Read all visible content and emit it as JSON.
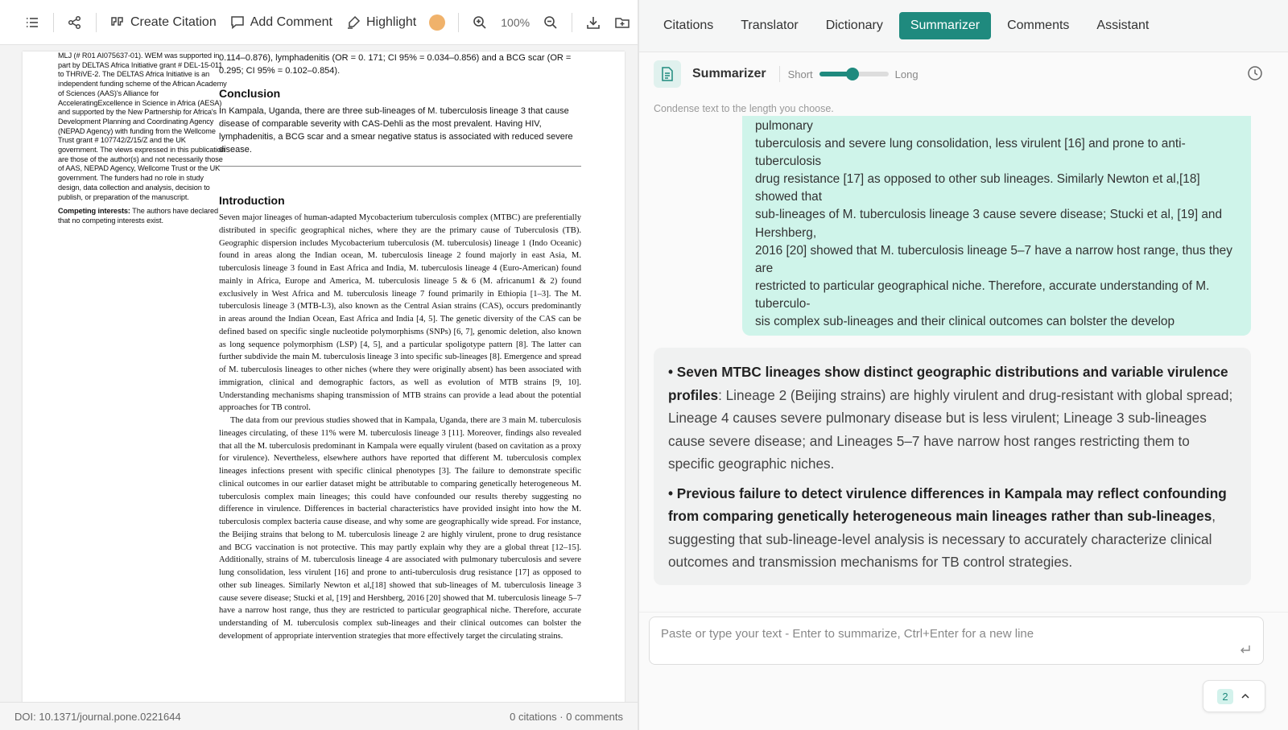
{
  "toolbar": {
    "create_citation": "Create Citation",
    "add_comment": "Add Comment",
    "highlight": "Highlight",
    "highlight_color": "#f0b26b",
    "zoom": "100%"
  },
  "document": {
    "side_column": [
      "MLJ (# R01 AI075637-01). WEM was supported in part by DELTAS Africa Initiative grant # DEL-15-011 to THRiVE-2. The DELTAS Africa Initiative is an independent funding scheme of the African Academy of Sciences (AAS)'s Alliance for AcceleratingExcellence in Science in Africa (AESA) and supported by the New Partnership for Africa's Development Planning and Coordinating Agency (NEPAD Agency) with funding from the Wellcome Trust grant # 107742/Z/15/Z and the UK government. The views expressed in this publication are those of the author(s) and not necessarily those of AAS, NEPAD Agency, Wellcome Trust or the UK government. The funders had no role in study design, data collection and analysis, decision to publish, or preparation of the manuscript."
    ],
    "competing_label": "Competing interests:",
    "competing_text": " The authors have declared that no competing interests exist.",
    "top_text": "0.114–0.876), lymphadenitis (OR = 0. 171; CI 95% = 0.034–0.856) and a BCG scar (OR = 0.295; CI 95% = 0.102–0.854).",
    "conclusion_heading": "Conclusion",
    "conclusion_text": "In Kampala, Uganda, there are three sub-lineages of M. tuberculosis lineage 3 that cause disease of comparable severity with CAS-Dehli as the most prevalent. Having HIV, lymphadenitis, a BCG scar and a smear negative status is associated with reduced severe disease.",
    "introduction_heading": "Introduction",
    "intro_p1": "Seven major lineages of human-adapted Mycobacterium tuberculosis complex (MTBC) are preferentially distributed in specific geographical niches, where they are the primary cause of Tuberculosis (TB). Geographic dispersion includes Mycobacterium tuberculosis (M. tuberculosis) lineage 1 (Indo Oceanic) found in areas along the Indian ocean, M. tuberculosis lineage 2 found majorly in east Asia, M. tuberculosis lineage 3 found in East Africa and India, M. tuberculosis lineage 4 (Euro-American) found mainly in Africa, Europe and America, M. tuberculosis lineage 5 & 6 (M. africanum1 & 2) found exclusively in West Africa and M. tuberculosis lineage 7 found primarily in Ethiopia [1–3]. The M. tuberculosis lineage 3 (MTB-L3), also known as the Central Asian strains (CAS), occurs predominantly in areas around the Indian Ocean, East Africa and India [4, 5]. The genetic diversity of the CAS can be defined based on specific single nucleotide polymorphisms (SNPs) [6, 7], genomic deletion, also known as long sequence polymorphism (LSP) [4, 5], and a particular spoligotype pattern [8]. The latter can further subdivide the main M. tuberculosis lineage 3 into specific sub-lineages [8]. Emergence and spread of M. tuberculosis lineages to other niches (where they were originally absent) has been associated with immigration, clinical and demographic factors, as well as evolution of MTB strains [9, 10]. Understanding mechanisms shaping transmission of MTB strains can provide a lead about the potential approaches for TB control.",
    "intro_p2": "The data from our previous studies showed that in Kampala, Uganda, there are 3 main M. tuberculosis lineages circulating, of these 11% were M. tuberculosis lineage 3 [11]. Moreover, findings also revealed that all the M. tuberculosis predominant in Kampala were equally virulent (based on cavitation as a proxy for virulence). Nevertheless, elsewhere authors have reported that different M. tuberculosis complex lineages infections present with specific clinical phenotypes [3]. The failure to demonstrate specific clinical outcomes in our earlier dataset might be attributable to comparing genetically heterogeneous M. tuberculosis complex main lineages; this could have confounded our results thereby suggesting no difference in virulence. Differences in bacterial characteristics have provided insight into how the M. tuberculosis complex bacteria cause disease, and why some are geographically wide spread. For instance, the Beijing strains that belong to M. tuberculosis lineage 2 are highly virulent, prone to drug resistance and BCG vaccination is not protective. This may partly explain why they are a global threat [12–15]. Additionally, strains of M. tuberculosis lineage 4 are associated with pulmonary tuberculosis and severe lung consolidation, less virulent [16] and prone to anti-tuberculosis drug resistance [17] as opposed to other sub lineages. Similarly Newton et al,[18] showed that sub-lineages of M. tuberculosis lineage 3 cause severe disease; Stucki et al, [19] and Hershberg, 2016 [20] showed that M. tuberculosis lineage 5–7 have a narrow host range, thus they are restricted to particular geographical niche. Therefore, accurate understanding of M. tuberculosis complex sub-lineages and their clinical outcomes can bolster the development of appropriate intervention strategies that more effectively target the circulating strains."
  },
  "status": {
    "doi": "DOI: 10.1371/journal.pone.0221644",
    "counts": "0 citations · 0 comments"
  },
  "tabs": [
    "Citations",
    "Translator",
    "Dictionary",
    "Summarizer",
    "Comments",
    "Assistant"
  ],
  "active_tab": "Summarizer",
  "summarizer": {
    "title": "Summarizer",
    "short_label": "Short",
    "long_label": "Long",
    "length_level": 0.48,
    "description": "Condense text to the length you choose.",
    "user_lines": [
      "pulmonary",
      "tuberculosis and severe lung consolidation, less virulent [16] and prone to anti-",
      "tuberculosis",
      "drug resistance [17] as opposed to other sub lineages. Similarly Newton et al,[18]",
      "showed that",
      "sub-lineages of M. tuberculosis lineage 3 cause severe disease; Stucki et al, [19] and",
      "Hershberg,",
      "2016 [20] showed that M. tuberculosis lineage 5–7 have a narrow host range, thus they",
      "are",
      "restricted to particular geographical niche. Therefore, accurate understanding of M.",
      "tuberculo-",
      "sis complex sub-lineages and their clinical outcomes can bolster the develop"
    ],
    "bullets": [
      {
        "bold": "• Seven MTBC lineages show distinct geographic distributions and variable virulence profiles",
        "text": ": Lineage 2 (Beijing strains) are highly virulent and drug-resistant with global spread; Lineage 4 causes severe pulmonary disease but is less virulent; Lineage 3 sub-lineages cause severe disease; and Lineages 5–7 have narrow host ranges restricting them to specific geographic niches."
      },
      {
        "bold": "• Previous failure to detect virulence differences in Kampala may reflect confounding from comparing genetically heterogeneous main lineages rather than sub-lineages",
        "text": ", suggesting that sub-lineage-level analysis is necessary to accurately characterize clinical outcomes and transmission mechanisms for TB control strategies."
      }
    ],
    "input_placeholder": "Paste or type your text - Enter to summarize, Ctrl+Enter for a new line",
    "page_badge": "2",
    "accent": "#1f8a7e"
  }
}
